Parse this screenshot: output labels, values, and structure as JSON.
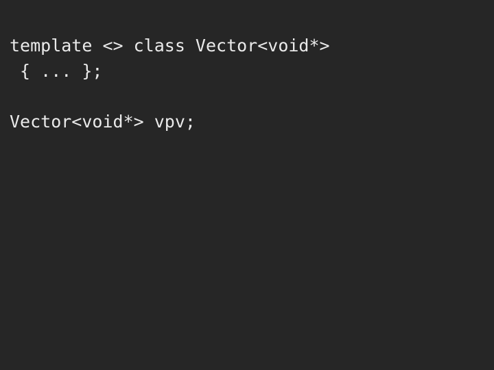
{
  "surface": {
    "background_color": "#262626",
    "text_color": "#eaeaea",
    "font_size_px": 25,
    "line_height_px": 37
  },
  "code": {
    "language": "cpp",
    "blocks": [
      {
        "name": "template-specialization-declaration",
        "lines": [
          "template <> class Vector<void*>",
          " { ... };"
        ]
      },
      {
        "name": "variable-declaration",
        "lines": [
          "Vector<void*> vpv;"
        ]
      }
    ],
    "lines": [
      "template <> class Vector<void*>",
      " { ... };",
      "",
      "Vector<void*> vpv;"
    ]
  }
}
